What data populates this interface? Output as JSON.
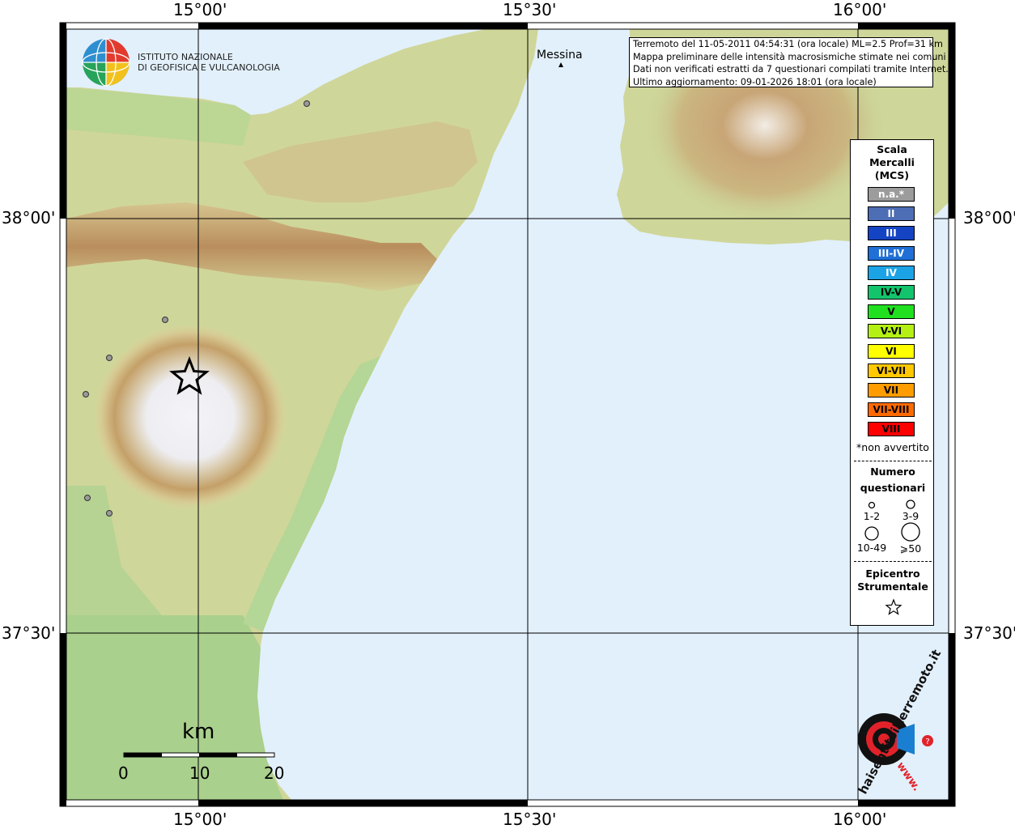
{
  "institution": {
    "line1": "ISTITUTO NAZIONALE",
    "line2": "DI GEOFISICA E VULCANOLOGIA"
  },
  "info": {
    "line1": "Terremoto del 11-05-2011 04:54:31 (ora locale) ML=2.5 Prof=31 km",
    "line2": "Mappa preliminare delle intensità macrosismiche stimate nei comuni",
    "line3": "Dati non verificati estratti da 7 questionari compilati tramite Internet.",
    "line4": "Ultimo aggiornamento: 09-01-2026 18:01 (ora locale)"
  },
  "grid_labels": {
    "top": [
      "15°00'",
      "15°30'",
      "16°00'"
    ],
    "bottom": [
      "15°00'",
      "15°30'",
      "16°00'"
    ],
    "left": [
      "38°00'",
      "37°30'"
    ],
    "right": [
      "38°00'",
      "37°30'"
    ]
  },
  "cities": {
    "messina": "Messina"
  },
  "legend": {
    "title_line1": "Scala",
    "title_line2": "Mercalli",
    "title_line3": "(MCS)",
    "items": [
      {
        "label": "n.a.*",
        "color": "#9c9c9c",
        "text": "#ffffff"
      },
      {
        "label": "II",
        "color": "#4d6db5",
        "text": "#ffffff"
      },
      {
        "label": "III",
        "color": "#1444c4",
        "text": "#ffffff"
      },
      {
        "label": "III-IV",
        "color": "#1f6fd6",
        "text": "#ffffff"
      },
      {
        "label": "IV",
        "color": "#1ca3e6",
        "text": "#ffffff"
      },
      {
        "label": "IV-V",
        "color": "#13c46c",
        "text": "#000000"
      },
      {
        "label": "V",
        "color": "#20e020",
        "text": "#000000"
      },
      {
        "label": "V-VI",
        "color": "#b4f014",
        "text": "#000000"
      },
      {
        "label": "VI",
        "color": "#ffff00",
        "text": "#000000"
      },
      {
        "label": "VI-VII",
        "color": "#ffc800",
        "text": "#000000"
      },
      {
        "label": "VII",
        "color": "#ff9c00",
        "text": "#000000"
      },
      {
        "label": "VII-VIII",
        "color": "#ff6a00",
        "text": "#000000"
      },
      {
        "label": "VIII",
        "color": "#ff0000",
        "text": "#000000"
      }
    ],
    "note": "*non avvertito",
    "questionnaires_title1": "Numero",
    "questionnaires_title2": "questionari",
    "q_sizes": [
      "1-2",
      "3-9",
      "10-49",
      "⩾50"
    ],
    "epicenter_title1": "Epicentro",
    "epicenter_title2": "Strumentale"
  },
  "scale_bar": {
    "unit": "km",
    "labels": [
      "0",
      "10",
      "20"
    ]
  },
  "hsh_logo": {
    "text": "haisentitoilterremoto.it",
    "prefix": "www."
  }
}
